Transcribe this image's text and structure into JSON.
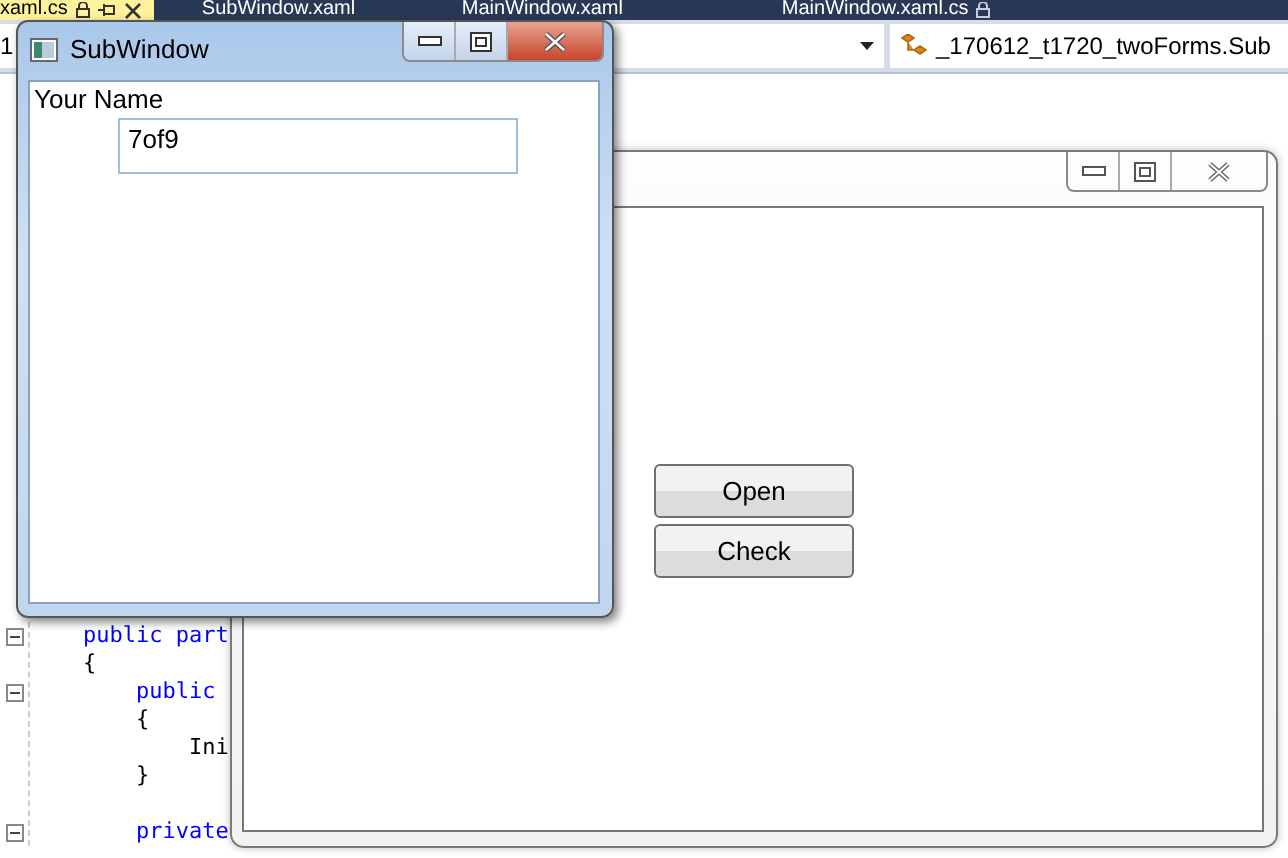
{
  "editor_tabs": [
    {
      "label": "xaml.cs",
      "selected": true,
      "locked": true,
      "pinnable": true,
      "closable": true
    },
    {
      "label": "SubWindow.xaml",
      "selected": false,
      "locked": false,
      "pinnable": false,
      "closable": false
    },
    {
      "label": "MainWindow.xaml",
      "selected": false,
      "locked": false,
      "pinnable": false,
      "closable": false
    },
    {
      "label": "MainWindow.xaml.cs",
      "selected": false,
      "locked": true,
      "pinnable": false,
      "closable": false
    }
  ],
  "nav_bar": {
    "left_combo": {
      "value": "1"
    },
    "right_combo": {
      "value": "_170612_t1720_twoForms.Sub"
    }
  },
  "code_lines": [
    {
      "kind": "keyword",
      "text": "    public part",
      "collapsible": true
    },
    {
      "kind": "plain",
      "text": "    {",
      "collapsible": false
    },
    {
      "kind": "keyword",
      "text": "        public",
      "collapsible": true
    },
    {
      "kind": "plain",
      "text": "        {",
      "collapsible": false
    },
    {
      "kind": "plain",
      "text": "            Ini",
      "collapsible": false
    },
    {
      "kind": "plain",
      "text": "        }",
      "collapsible": false
    },
    {
      "kind": "blank"
    },
    {
      "kind": "keyword",
      "text": "        private",
      "collapsible": true
    }
  ],
  "main_window": {
    "active": false,
    "buttons": [
      {
        "label": "Open"
      },
      {
        "label": "Check"
      }
    ]
  },
  "sub_window": {
    "active": true,
    "title": "SubWindow",
    "label": "Your Name",
    "name_field": {
      "value": "7of9"
    }
  }
}
